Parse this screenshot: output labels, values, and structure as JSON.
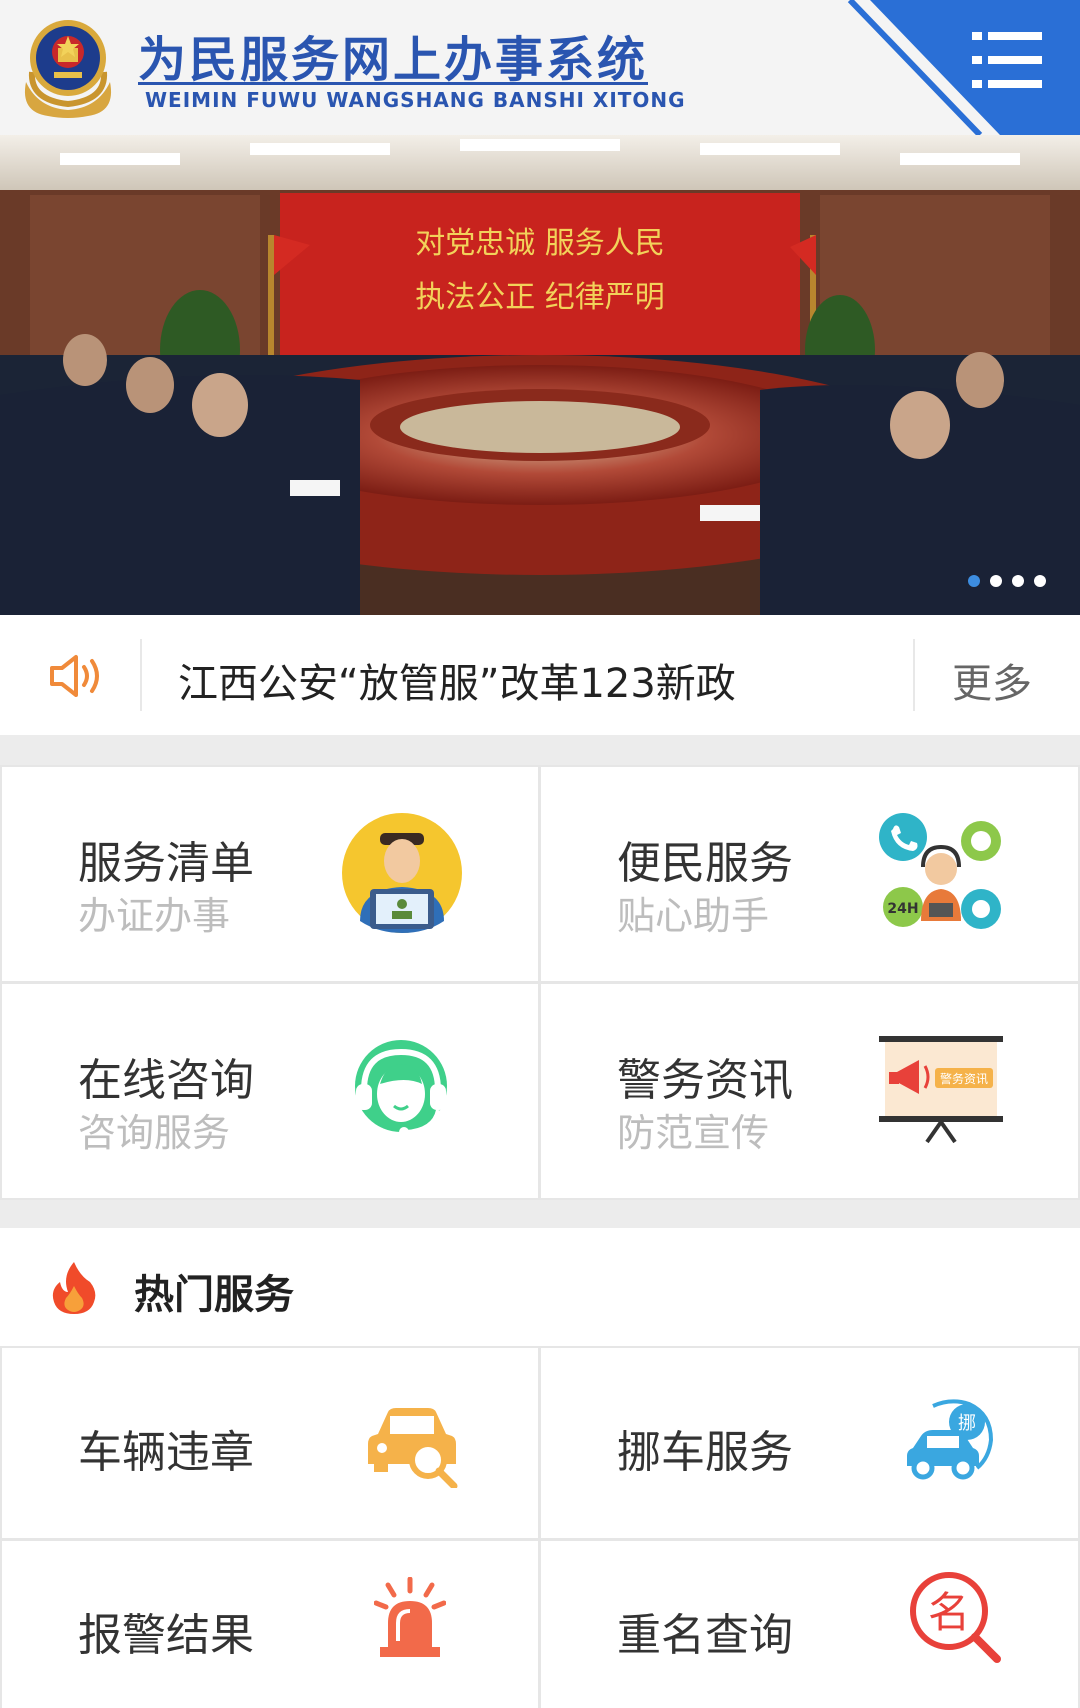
{
  "header": {
    "title_cn": "为民服务网上办事系统",
    "title_en": "WEIMIN FUWU WANGSHANG BANSHI XITONG",
    "menu_icon": "hamburger-menu-icon",
    "accent_color": "#2a6fd6"
  },
  "banner": {
    "slogan_line1": "对党忠诚  服务人民",
    "slogan_line2": "执法公正  纪律严明",
    "slide_count": 4,
    "active_slide": 1
  },
  "notice": {
    "icon": "speaker-icon",
    "text": "江西公安“放管服”改革123新政",
    "more_label": "更多"
  },
  "services": [
    {
      "title": "服务清单",
      "subtitle": "办证办事",
      "icon": "officer-icon"
    },
    {
      "title": "便民服务",
      "subtitle": "贴心助手",
      "icon": "customer-service-icon"
    },
    {
      "title": "在线咨询",
      "subtitle": "咨询服务",
      "icon": "headset-icon"
    },
    {
      "title": "警务资讯",
      "subtitle": "防范宣传",
      "icon": "megaphone-board-icon",
      "badge": "警务资讯"
    }
  ],
  "hot": {
    "icon": "fire-icon",
    "label": "热门服务",
    "items": [
      {
        "title": "车辆违章",
        "icon": "car-search-icon"
      },
      {
        "title": "挪车服务",
        "icon": "move-car-icon",
        "badge": "挪"
      },
      {
        "title": "报警结果",
        "icon": "alarm-light-icon"
      },
      {
        "title": "重名查询",
        "icon": "name-search-icon",
        "badge": "名"
      }
    ]
  }
}
